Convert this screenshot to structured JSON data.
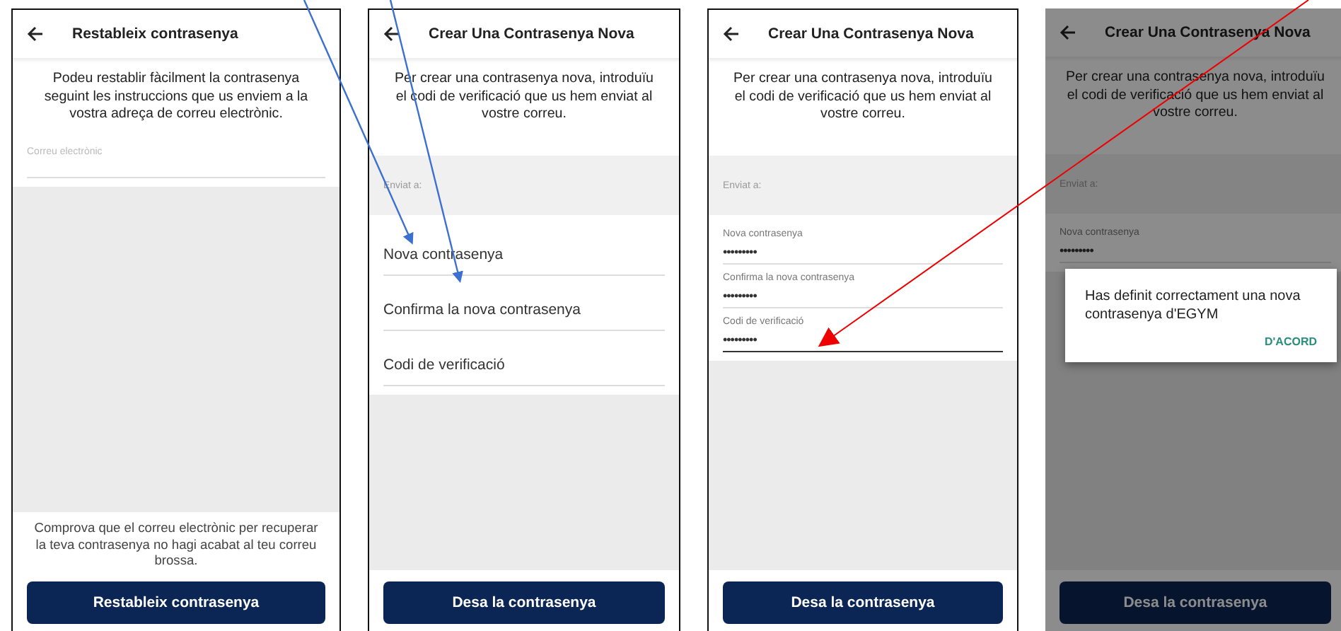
{
  "screens": [
    {
      "kind": "reset",
      "title": "Restableix contrasenya",
      "intro": "Podeu restablir fàcilment la contrasenya seguint les instruccions que us enviem a la vostra adreça de correu electrònic.",
      "fields": [
        {
          "label": "Correu electrònic",
          "focused": false
        }
      ],
      "note": "Comprova que el correu electrònic per recuperar la teva contrasenya no hagi acabat al teu correu brossa.",
      "button": "Restableix contrasenya",
      "dimmed": false
    },
    {
      "kind": "create",
      "title": "Crear Una Contrasenya Nova",
      "intro": "Per crear una contrasenya nova, introduïu el codi de verificació que us hem enviat al vostre correu.",
      "sent_to": "Enviat a:",
      "fields": [
        {
          "placeholder": "Nova contrasenya"
        },
        {
          "placeholder": "Confirma la nova contrasenya"
        },
        {
          "placeholder": "Codi de verificació"
        }
      ],
      "button": "Desa la contrasenya",
      "dimmed": false
    },
    {
      "kind": "create",
      "title": "Crear Una Contrasenya Nova",
      "intro": "Per crear una contrasenya nova, introduïu el codi de verificació que us hem enviat al vostre correu.",
      "sent_to": "Enviat a:",
      "fields": [
        {
          "label": "Nova contrasenya",
          "value": "•••••••••",
          "focused": false
        },
        {
          "label": "Confirma la nova contrasenya",
          "value": "•••••••••",
          "focused": false
        },
        {
          "label": "Codi de verificació",
          "value": "•••••••••",
          "focused": true
        }
      ],
      "button": "Desa la contrasenya",
      "dimmed": false
    },
    {
      "kind": "create",
      "title": "Crear Una Contrasenya Nova",
      "intro": "Per crear una contrasenya nova, introduïu el codi de verificació que us hem enviat al vostre correu.",
      "sent_to": "Enviat a:",
      "fields": [
        {
          "label": "Nova contrasenya",
          "value": "•••••••••",
          "focused": false
        }
      ],
      "button": "Desa la contrasenya",
      "dimmed": true,
      "dialog": {
        "message": "Has definit correctament una nova contrasenya d'EGYM",
        "button": "D'ACORD"
      }
    }
  ]
}
